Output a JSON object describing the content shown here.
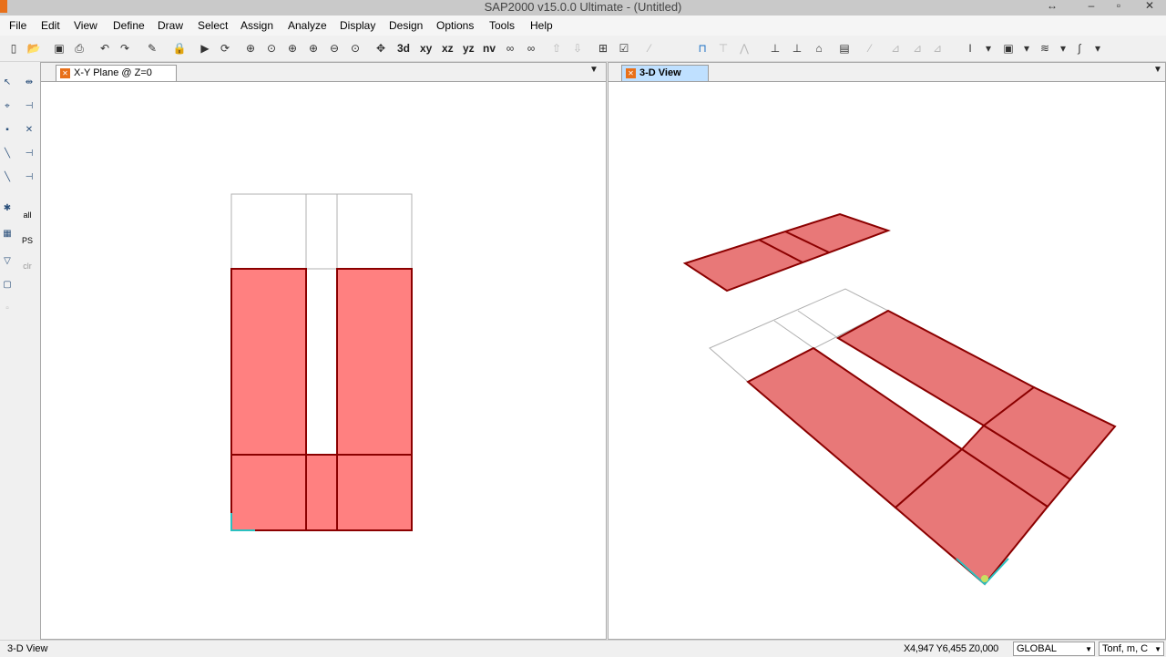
{
  "window": {
    "title": "SAP2000 v15.0.0 Ultimate  - (Untitled)"
  },
  "menu": [
    "File",
    "Edit",
    "View",
    "Define",
    "Draw",
    "Select",
    "Assign",
    "Analyze",
    "Display",
    "Design",
    "Options",
    "Tools",
    "Help"
  ],
  "toolbar": {
    "view_labels": [
      "xy",
      "xz",
      "yz",
      "nv"
    ],
    "sd_label": "3d"
  },
  "sidebar": {
    "all_label": "all",
    "ps_label": "PS",
    "clr_label": "clr"
  },
  "panels": {
    "left": {
      "tab": "X-Y Plane @ Z=0"
    },
    "right": {
      "tab": "3-D View"
    }
  },
  "colors": {
    "area_fill": "#ff8080",
    "area_stroke": "#8b0000",
    "tab_active": "#bfe0ff",
    "app_accent": "#e8701a"
  },
  "status": {
    "view": "3-D View",
    "coords": "X4,947  Y6,455  Z0,000",
    "coord_system": "GLOBAL",
    "units": "Tonf, m, C"
  }
}
